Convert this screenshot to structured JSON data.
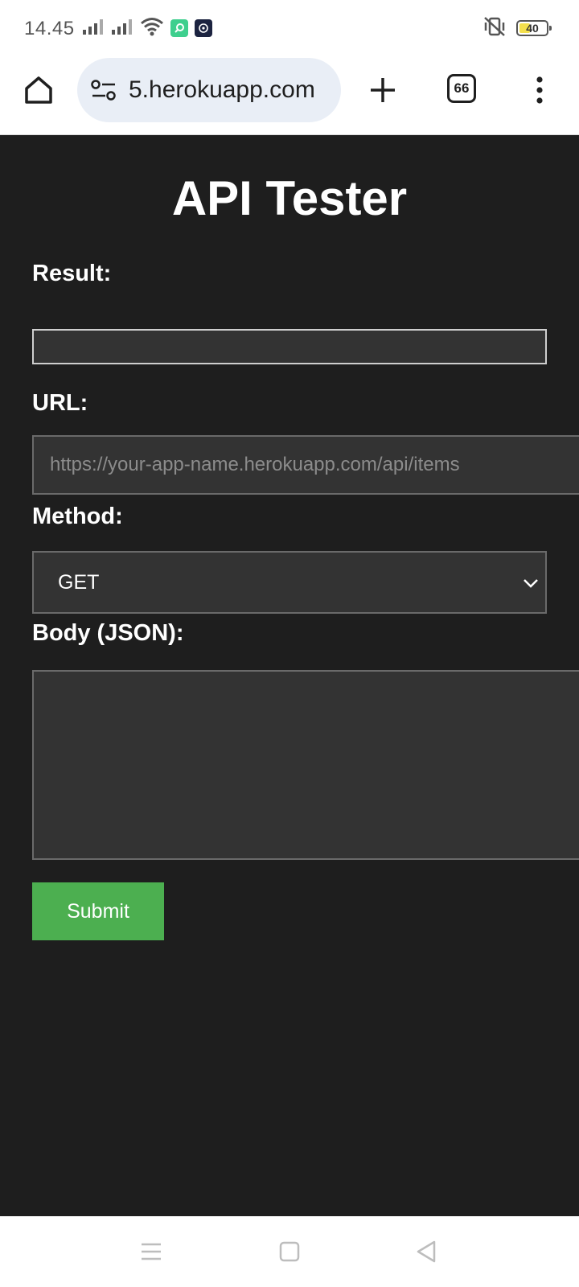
{
  "status_bar": {
    "time": "14.45",
    "battery_level": "40",
    "battery_fraction": 0.4,
    "icons": [
      "signal-icon",
      "signal-icon",
      "wifi-icon",
      "app-notification-icon",
      "app-notification-icon",
      "vibrate-mute-icon",
      "battery-icon"
    ]
  },
  "browser": {
    "url": "5.herokuapp.com",
    "tab_count": "66",
    "icons": [
      "home-icon",
      "site-settings-icon",
      "plus-icon",
      "tabs-icon",
      "more-vert-icon"
    ]
  },
  "page": {
    "title": "API Tester",
    "result_label": "Result:",
    "result_value": "",
    "url_label": "URL:",
    "url_placeholder": "https://your-app-name.herokuapp.com/api/items",
    "method_label": "Method:",
    "method_value": "GET",
    "body_label": "Body (JSON):",
    "body_value": "",
    "submit_label": "Submit"
  },
  "colors": {
    "page_background": "#1e1e1e",
    "field_background": "#333333",
    "submit_button": "#4caf50",
    "battery_fill": "#f4e04d"
  },
  "nav_bar": {
    "icons": [
      "recent-apps-icon",
      "home-nav-icon",
      "back-icon"
    ]
  }
}
